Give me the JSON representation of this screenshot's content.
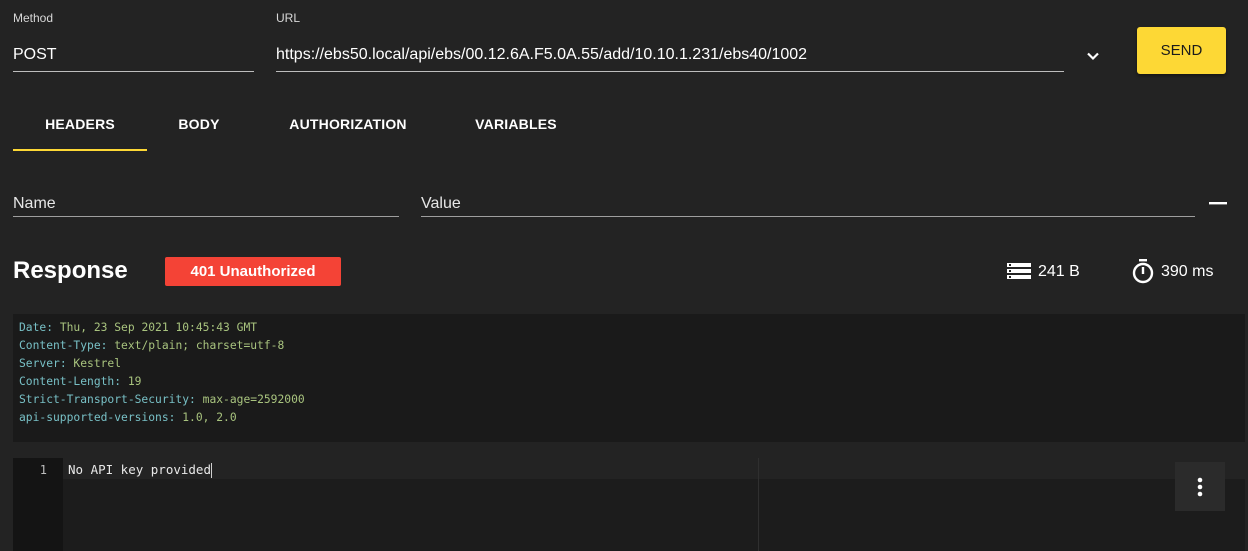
{
  "request": {
    "method_label": "Method",
    "method_value": "POST",
    "url_label": "URL",
    "url_value": "https://ebs50.local/api/ebs/00.12.6A.F5.0A.55/add/10.10.1.231/ebs40/1002",
    "send_label": "SEND"
  },
  "tabs": [
    {
      "label": "HEADERS",
      "active": true
    },
    {
      "label": "BODY",
      "active": false
    },
    {
      "label": "AUTHORIZATION",
      "active": false
    },
    {
      "label": "VARIABLES",
      "active": false
    }
  ],
  "header_row": {
    "name_placeholder": "Name",
    "value_placeholder": "Value"
  },
  "response": {
    "title": "Response",
    "status": "401 Unauthorized",
    "status_color": "#f44336",
    "size": "241 B",
    "time": "390 ms",
    "headers": [
      {
        "key": "Date",
        "value": "Thu, 23 Sep 2021 10:45:43 GMT"
      },
      {
        "key": "Content-Type",
        "value": "text/plain; charset=utf-8"
      },
      {
        "key": "Server",
        "value": "Kestrel"
      },
      {
        "key": "Content-Length",
        "value": "19"
      },
      {
        "key": "Strict-Transport-Security",
        "value": "max-age=2592000"
      },
      {
        "key": "api-supported-versions",
        "value": "1.0, 2.0"
      }
    ],
    "body_lines": [
      {
        "number": "1",
        "text": "No API key provided"
      }
    ]
  },
  "colors": {
    "accent": "#fdd835",
    "background": "#232323"
  },
  "icons": {
    "url_dropdown": "chevron-down-icon",
    "remove_header": "minus-icon",
    "size": "storage-icon",
    "time": "timer-icon",
    "menu": "more-vertical-icon"
  }
}
